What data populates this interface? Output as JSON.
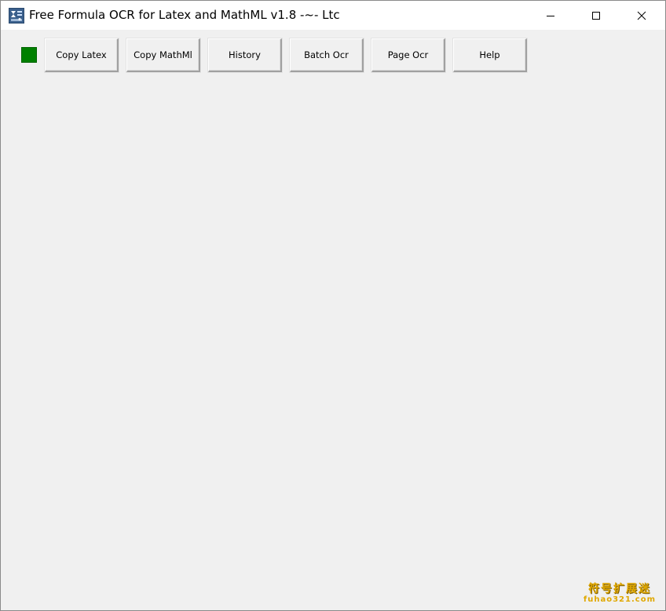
{
  "window": {
    "title": "Free Formula OCR for Latex and MathML v1.8 -~- Ltc",
    "icon": "app-icon",
    "controls": {
      "minimize": "minimize-icon",
      "maximize": "maximize-icon",
      "close": "close-icon"
    }
  },
  "toolbar": {
    "status_color": "#008000",
    "buttons": [
      {
        "label": "Copy Latex"
      },
      {
        "label": "Copy MathMl"
      },
      {
        "label": "History"
      },
      {
        "label": "Batch Ocr"
      },
      {
        "label": "Page Ocr"
      },
      {
        "label": "Help"
      }
    ]
  },
  "watermark": {
    "text_cn": "符号扩展迷",
    "url": "fuhao321.com"
  }
}
